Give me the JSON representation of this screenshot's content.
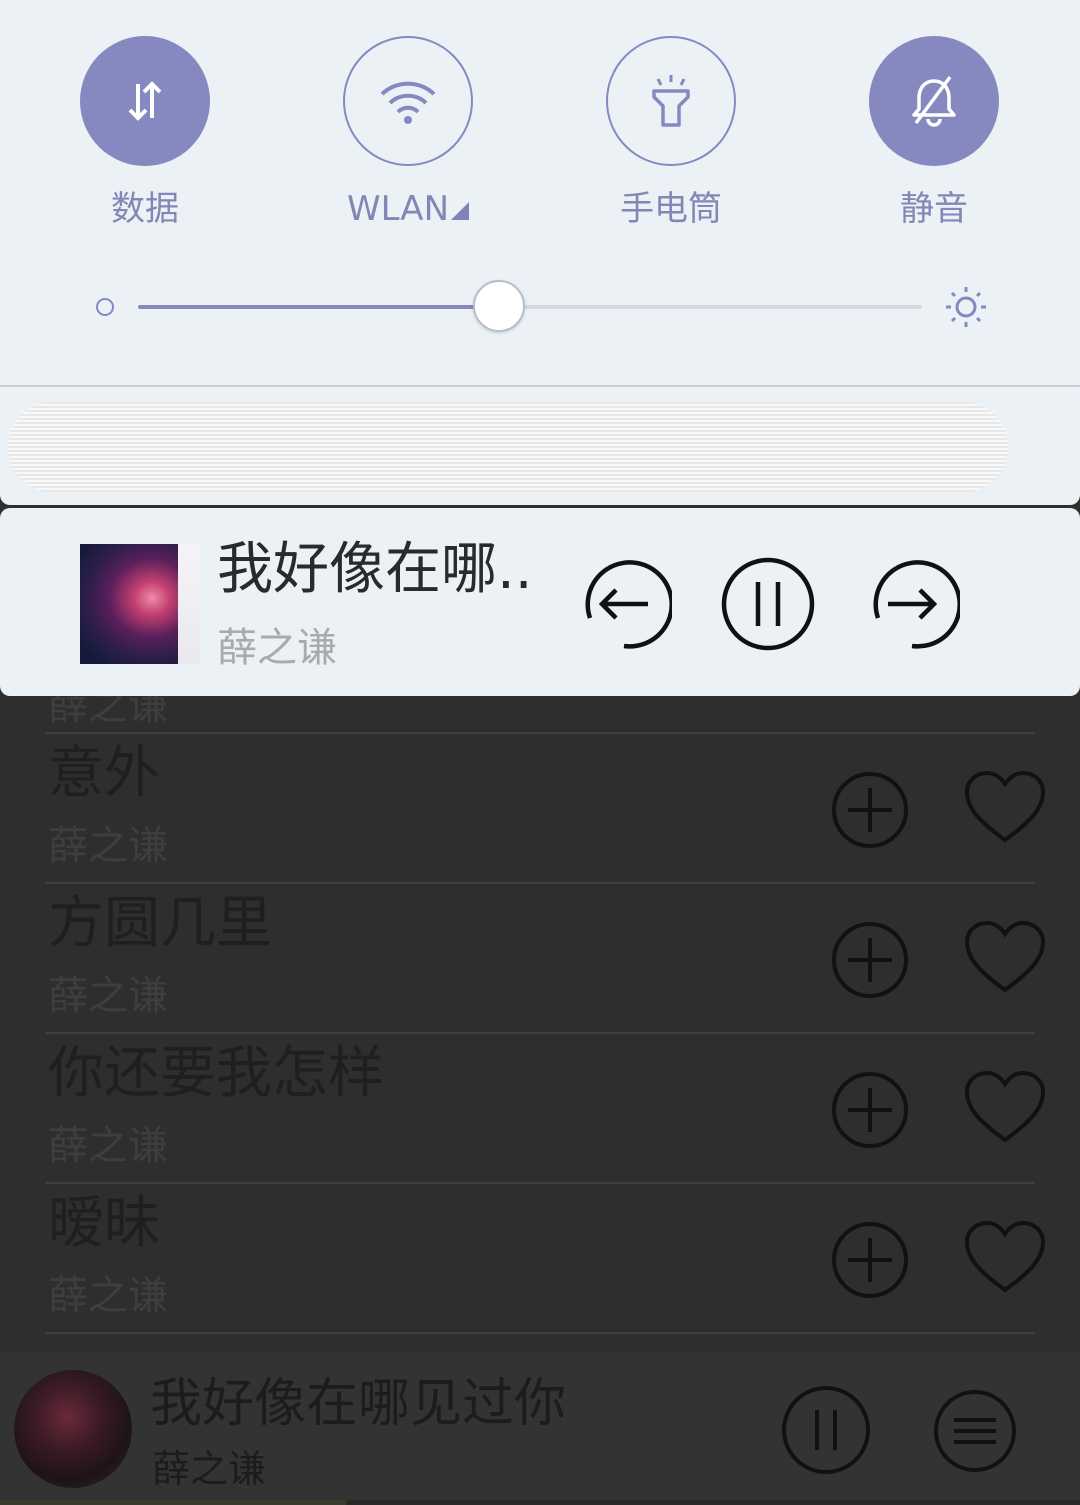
{
  "quick_settings": {
    "toggles": [
      {
        "label": "数据",
        "icon": "data-arrows-icon",
        "state": "on"
      },
      {
        "label": "WLAN",
        "icon": "wifi-icon",
        "state": "off"
      },
      {
        "label": "手电筒",
        "icon": "flashlight-icon",
        "state": "off"
      },
      {
        "label": "静音",
        "icon": "bell-off-icon",
        "state": "on"
      }
    ],
    "brightness_level": 0.46
  },
  "media_notification": {
    "title": "我好像在哪..",
    "artist": "薛之谦",
    "controls": [
      "previous",
      "pause",
      "next"
    ]
  },
  "song_list": {
    "partial_artist_top": "薛之谦",
    "rows": [
      {
        "title": "意外",
        "artist": "薛之谦"
      },
      {
        "title": "方圆几里",
        "artist": "薛之谦"
      },
      {
        "title": "你还要我怎样",
        "artist": "薛之谦"
      },
      {
        "title": "暧昧",
        "artist": "薛之谦"
      }
    ]
  },
  "now_playing_bar": {
    "title": "我好像在哪见过你",
    "artist": "薛之谦",
    "progress": 0.32
  },
  "colors": {
    "accent": "#8589c0",
    "shade_bg": "#ebf1f4",
    "app_bg": "#2e2e2e"
  }
}
